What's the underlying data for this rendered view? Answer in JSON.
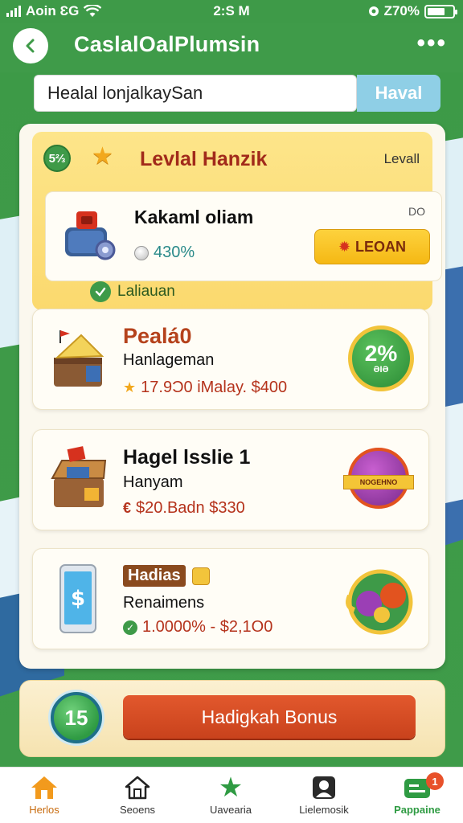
{
  "status_bar": {
    "carrier": "Aoin ƐG",
    "time": "2:S M",
    "battery": "Z70%",
    "battery_level": 0.7
  },
  "header": {
    "title": "CaslalOalPlumsin"
  },
  "search": {
    "value": "Healal lonjalkaySan",
    "button_label": "Haval"
  },
  "level": {
    "badge": "5⅔",
    "title": "Levlal Hanzik",
    "link": "Levall"
  },
  "featured_offer": {
    "title": "Kakaml oliam",
    "progress_text": "430%",
    "corner": "DO",
    "claim_label": "LEOAN"
  },
  "section": {
    "label": "Laliauan"
  },
  "offers": [
    {
      "title": "Pealá0",
      "subtitle": "Hanlageman",
      "meta": "17.9Ɔ0 iMalay. $400",
      "reward": "2%",
      "reward_sub": "ƏIƏ"
    },
    {
      "title": "Hagel lsslie 1",
      "subtitle": "Hanyam",
      "meta": "$20.Badn $330",
      "reward": "NOGEHNO"
    },
    {
      "title": "Hadias",
      "subtitle": "Renaimens",
      "meta": "1.0000% - $2,1O0"
    }
  ],
  "bonus": {
    "badge": "15",
    "button_label": "Hadigkah Bonus"
  },
  "nav": {
    "items": [
      {
        "label": "Herlos"
      },
      {
        "label": "Seoens"
      },
      {
        "label": "Uavearia"
      },
      {
        "label": "Lielemosik"
      },
      {
        "label": "Pappaine"
      }
    ],
    "notification_count": "1"
  },
  "colors": {
    "brand_green": "#3f9b49",
    "accent_yellow": "#fbd96e",
    "accent_orange": "#c9421c",
    "money_red": "#b5331c"
  }
}
